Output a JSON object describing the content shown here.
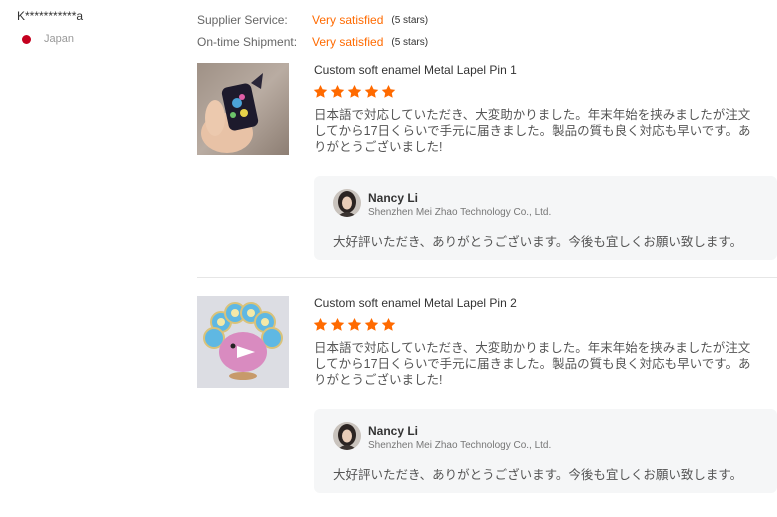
{
  "buyer": {
    "name": "K***********a",
    "country": "Japan",
    "flag_color": "#c4001e"
  },
  "ratings": [
    {
      "label": "Supplier Service:",
      "value": "Very satisfied",
      "note": "(5 stars)"
    },
    {
      "label": "On-time Shipment:",
      "value": "Very satisfied",
      "note": "(5 stars)"
    }
  ],
  "colors": {
    "accent": "#ff6a00",
    "star": "#ff6a00",
    "reply_bg": "#f5f6f7"
  },
  "reviews": [
    {
      "product_title": "Custom soft enamel Metal Lapel Pin 1",
      "stars": 5,
      "text": "日本語で対応していただき、大変助かりました。年末年始を挟みましたが注文してから17日くらいで手元に届きました。製品の質も良く対応も早いです。ありがとうございました!",
      "reply": {
        "name": "Nancy Li",
        "company": "Shenzhen Mei Zhao Technology Co., Ltd.",
        "text": "大好評いただき、ありがとうございます。今後も宜しくお願い致します。"
      }
    },
    {
      "product_title": "Custom soft enamel Metal Lapel Pin 2",
      "stars": 5,
      "text": "日本語で対応していただき、大変助かりました。年末年始を挟みましたが注文してから17日くらいで手元に届きました。製品の質も良く対応も早いです。ありがとうございました!",
      "reply": {
        "name": "Nancy Li",
        "company": "Shenzhen Mei Zhao Technology Co., Ltd.",
        "text": "大好評いただき、ありがとうございます。今後も宜しくお願い致します。"
      }
    }
  ]
}
